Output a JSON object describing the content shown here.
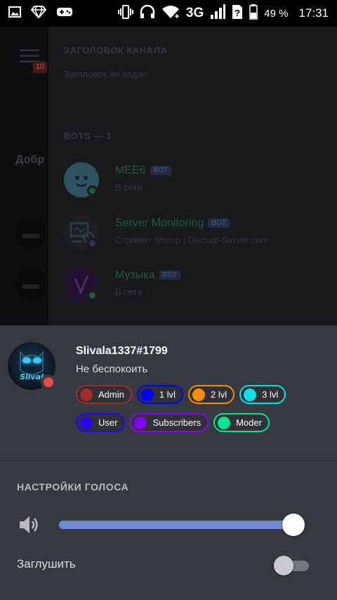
{
  "status_bar": {
    "network": "3G",
    "battery_percent": "49 %",
    "battery_level": 0.49,
    "time": "17:31",
    "left_icons": [
      "image-icon",
      "gem-icon",
      "gamepad-icon"
    ],
    "right_icons": [
      "vibrate-icon",
      "headphones-icon",
      "wifi-icon",
      "signal-icon",
      "unknown-sim-icon",
      "battery-icon"
    ]
  },
  "background": {
    "channel_topic_heading": "ЗАГОЛОВОК КАНАЛА",
    "channel_topic_value": "Заголовок не задан.",
    "rail_badge": "10",
    "rail_welcome_text": "Добр",
    "bots_heading": "BOTS — 3",
    "members": [
      {
        "name": "MEE6",
        "badge": "BOT",
        "status": "В сети",
        "status_color": "#1b5e3a"
      },
      {
        "name": "Server Monitoring",
        "badge": "BOT",
        "status": "Стримит !Bump | Discord-Server.com",
        "status_color": "#3b2a5c"
      },
      {
        "name": "Музыка",
        "badge": "BOT",
        "status": "В сети",
        "status_color": "#1b5e3a"
      }
    ]
  },
  "profile": {
    "username": "Slivala1337#1799",
    "status_text": "Не беспокоить",
    "status_color": "#f04747",
    "avatar_text": "Slival",
    "roles": [
      [
        {
          "label": "Admin",
          "color": "#a52a2a"
        },
        {
          "label": "1 lvl",
          "color": "#0000ff"
        },
        {
          "label": "2 lvl",
          "color": "#ff8c00"
        },
        {
          "label": "3 lvl",
          "color": "#00e5e5"
        }
      ],
      [
        {
          "label": "User",
          "color": "#2a00ff"
        },
        {
          "label": "Subscribers",
          "color": "#8a00ff"
        },
        {
          "label": "Moder",
          "color": "#00e690"
        }
      ]
    ]
  },
  "voice_settings": {
    "title": "НАСТРОЙКИ ГОЛОСА",
    "volume_level": 1.0,
    "mute_label": "Заглушить",
    "mute_enabled": false,
    "accent_color": "#7289da"
  }
}
